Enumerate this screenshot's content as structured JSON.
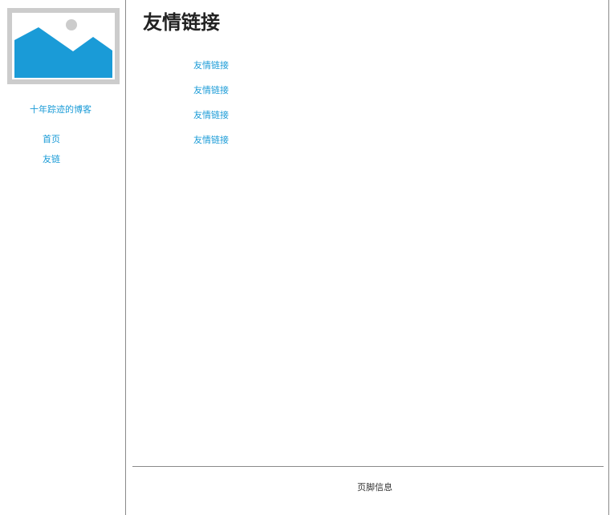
{
  "sidebar": {
    "logo_icon": "image-placeholder-icon",
    "blog_name": "十年踪迹的博客",
    "nav": [
      "首页",
      "友链"
    ]
  },
  "main": {
    "title": "友情链接",
    "links": [
      "友情链接",
      "友情链接",
      "友情链接",
      "友情链接"
    ]
  },
  "footer": {
    "text": "页脚信息"
  },
  "colors": {
    "link": "#1a9bd7",
    "placeholder_fill": "#1a9bd7",
    "placeholder_frame": "#cccccc",
    "border": "#8a8a8a"
  }
}
